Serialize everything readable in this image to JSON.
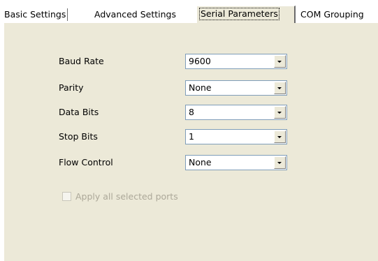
{
  "tabs": [
    {
      "label": "Basic Settings",
      "active": false
    },
    {
      "label": "Advanced Settings",
      "active": false
    },
    {
      "label": "Serial Parameters",
      "active": true
    },
    {
      "label": "COM Grouping",
      "active": false
    }
  ],
  "fields": {
    "baud_rate": {
      "label": "Baud Rate",
      "value": "9600"
    },
    "parity": {
      "label": "Parity",
      "value": "None"
    },
    "data_bits": {
      "label": "Data Bits",
      "value": "8"
    },
    "stop_bits": {
      "label": "Stop Bits",
      "value": "1"
    },
    "flow_control": {
      "label": "Flow Control",
      "value": "None"
    }
  },
  "apply_all": {
    "label": "Apply all selected ports",
    "checked": false,
    "enabled": false
  },
  "colors": {
    "panel_bg": "#ece9d8",
    "combo_border": "#7f9db9",
    "disabled_text": "#aca899"
  },
  "icons": {
    "dropdown": "chevron-down-icon"
  }
}
